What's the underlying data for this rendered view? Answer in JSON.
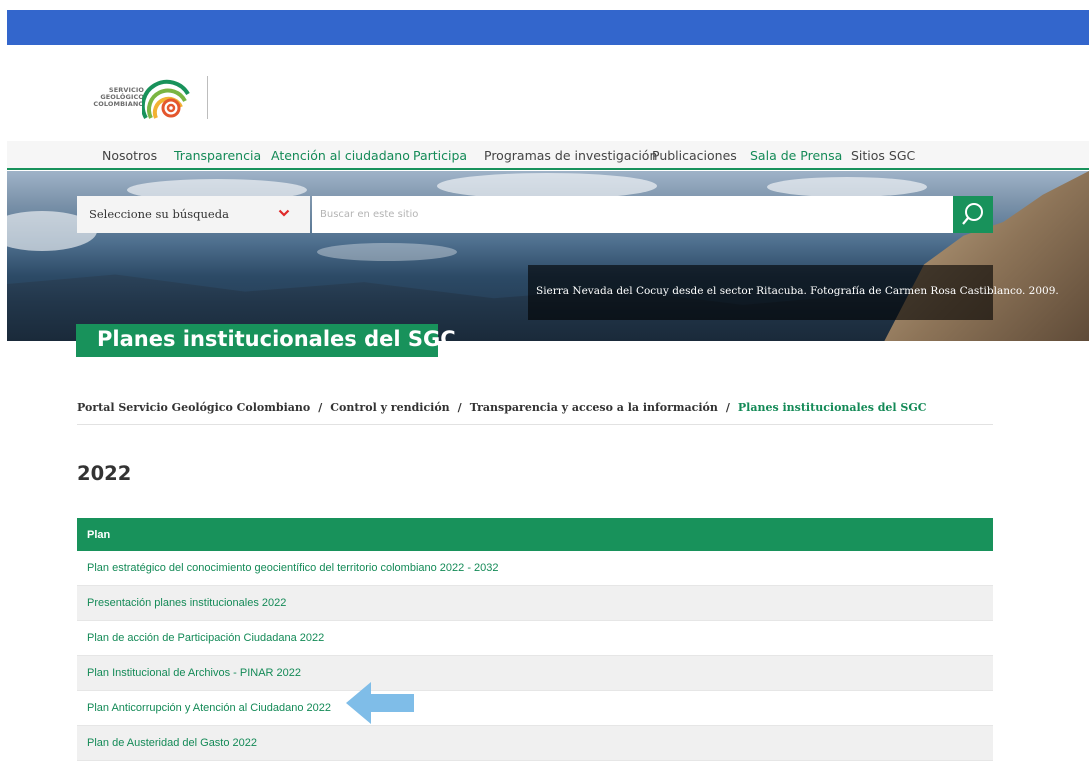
{
  "logo": {
    "line1": "SERVICIO",
    "line2": "GEOLÓGICO",
    "line3": "COLOMBIANO",
    "colors": [
      "#18925b",
      "#7ab542",
      "#f2b233",
      "#e4572e"
    ]
  },
  "nav": {
    "items": [
      {
        "label": "Nosotros",
        "color": "dark"
      },
      {
        "label": "Transparencia",
        "color": "green"
      },
      {
        "label": "Atención al ciudadano",
        "color": "green"
      },
      {
        "label": "Participa",
        "color": "green"
      },
      {
        "label": "Programas de investigación",
        "color": "dark"
      },
      {
        "label": "Publicaciones",
        "color": "dark"
      },
      {
        "label": "Sala de Prensa",
        "color": "green"
      },
      {
        "label": "Sitios SGC",
        "color": "dark"
      }
    ]
  },
  "search": {
    "select_label": "Seleccione su búsqueda",
    "placeholder": "Buscar en este sitio",
    "icon": "search-icon"
  },
  "hero": {
    "caption": "Sierra Nevada del Cocuy desde el sector Ritacuba.  Fotografía de Carmen Rosa Castiblanco. 2009."
  },
  "page": {
    "title": "Planes institucionales del SGC",
    "year": "2022"
  },
  "breadcrumb": {
    "items": [
      "Portal Servicio Geológico Colombiano",
      "Control y rendición",
      "Transparencia y acceso a la información"
    ],
    "current": "Planes institucionales del SGC",
    "separator": "/"
  },
  "table": {
    "header": "Plan",
    "rows": [
      "Plan estratégico del conocimiento geocientífico del territorio colombiano 2022 - 2032",
      "Presentación planes institucionales 2022",
      "Plan de acción de Participación Ciudadana 2022",
      "Plan Institucional de Archivos - PINAR 2022",
      "Plan Anticorrupción y Atención al Ciudadano 2022",
      "Plan de Austeridad del Gasto 2022"
    ]
  },
  "colors": {
    "top_bar": "#3366cc",
    "brand_green": "#18925b",
    "link_green": "#148a57",
    "arrow": "#7fbde8"
  }
}
